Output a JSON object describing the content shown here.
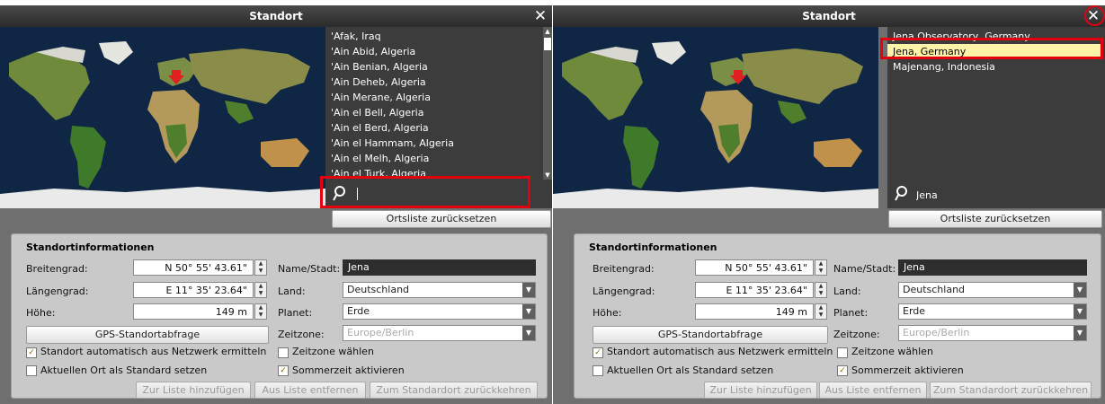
{
  "dialog_title": "Standort",
  "close_glyph": "✕",
  "left": {
    "cities": [
      "'Afak, Iraq",
      "'Ain Abid, Algeria",
      "'Ain Benian, Algeria",
      "'Ain Deheb, Algeria",
      "'Ain Merane, Algeria",
      "'Ain el Bell, Algeria",
      "'Ain el Berd, Algeria",
      "'Ain el Hammam, Algeria",
      "'Ain el Melh, Algeria",
      "'Ain el Turk, Algeria"
    ],
    "search_value": ""
  },
  "right": {
    "cities": [
      "Jena Observatory, Germany",
      "Jena, Germany",
      "Majenang, Indonesia"
    ],
    "selected_city": "Jena, Germany",
    "search_value": "Jena"
  },
  "reset_list_label": "Ortsliste zurücksetzen",
  "info": {
    "title": "Standortinformationen",
    "latitude_label": "Breitengrad:",
    "latitude_value": "N 50° 55' 43.61\"",
    "longitude_label": "Längengrad:",
    "longitude_value": "E 11° 35' 23.64\"",
    "altitude_label": "Höhe:",
    "altitude_value": "149 m",
    "name_label": "Name/Stadt:",
    "name_value": "Jena",
    "country_label": "Land:",
    "country_value": "Deutschland",
    "planet_label": "Planet:",
    "planet_value": "Erde",
    "timezone_label": "Zeitzone:",
    "timezone_value": "Europe/Berlin",
    "gps_button": "GPS-Standortabfrage",
    "auto_network_label": "Standort automatisch aus Netzwerk ermitteln",
    "auto_network_checked": true,
    "set_default_label": "Aktuellen Ort als Standard setzen",
    "set_default_checked": false,
    "choose_timezone_label": "Zeitzone wählen",
    "choose_timezone_checked": false,
    "dst_label": "Sommerzeit aktivieren",
    "dst_checked": true,
    "add_to_list": "Zur Liste hinzufügen",
    "remove_from_list": "Aus Liste entfernen",
    "return_default": "Zum Standardort zurückkehren"
  },
  "colors": {
    "highlight_red": "#e3000f",
    "selected_row": "#fff3a8",
    "checkmark": "#8a6a00"
  }
}
